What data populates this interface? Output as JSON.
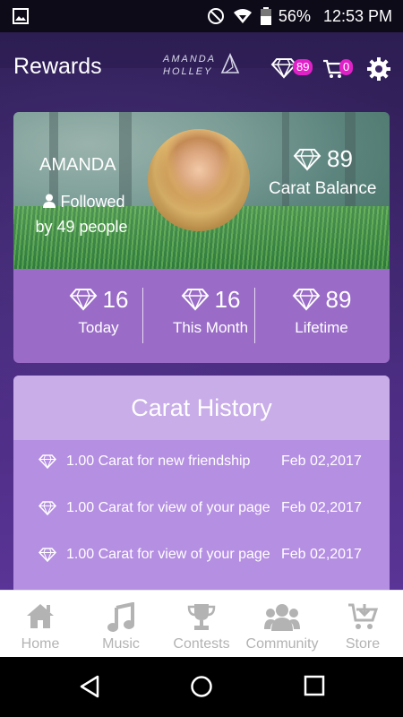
{
  "status_bar": {
    "battery": "56%",
    "time": "12:53 PM",
    "icons": [
      "image-icon",
      "dnd-icon",
      "wifi-icon",
      "battery-icon"
    ]
  },
  "header": {
    "title": "Rewards",
    "logo_line1": "AMANDA",
    "logo_line2": "HOLLEY",
    "carat_badge": "89",
    "cart_badge": "0"
  },
  "profile": {
    "name": "AMANDA",
    "followed_line1": "Followed",
    "followed_line2": "by 49 people",
    "balance_value": "89",
    "balance_label": "Carat Balance"
  },
  "stats": [
    {
      "value": "16",
      "label": "Today"
    },
    {
      "value": "16",
      "label": "This Month"
    },
    {
      "value": "89",
      "label": "Lifetime"
    }
  ],
  "history": {
    "title": "Carat History",
    "items": [
      {
        "desc": "1.00 Carat for new friendship",
        "date": "Feb 02,2017"
      },
      {
        "desc": "1.00 Carat for view of your page",
        "date": "Feb 02,2017"
      },
      {
        "desc": "1.00 Carat for view of your page",
        "date": "Feb 02,2017"
      }
    ]
  },
  "tabs": [
    {
      "label": "Home",
      "icon": "home-icon"
    },
    {
      "label": "Music",
      "icon": "music-icon"
    },
    {
      "label": "Contests",
      "icon": "trophy-icon"
    },
    {
      "label": "Community",
      "icon": "community-icon"
    },
    {
      "label": "Store",
      "icon": "store-icon"
    }
  ],
  "colors": {
    "badge": "#e021c8",
    "stats_bg": "#9a6cc8",
    "history_bg": "#b58fe2",
    "history_header": "#c8ade8",
    "tab_inactive": "#b3b3b3"
  }
}
